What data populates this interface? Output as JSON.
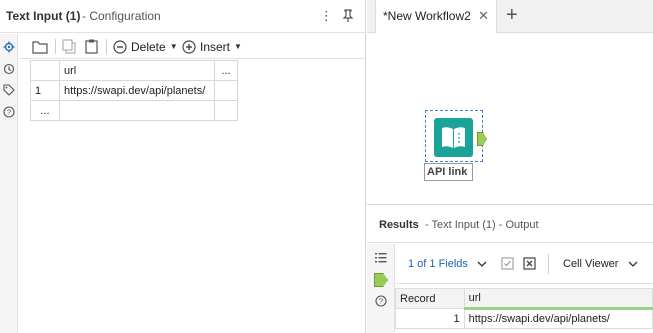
{
  "config": {
    "title": "Text Input (1)",
    "subtitle": "- Configuration"
  },
  "toolbar": {
    "delete_label": "Delete",
    "insert_label": "Insert"
  },
  "input_grid": {
    "header_cell": "url",
    "header_more": "...",
    "rows": [
      {
        "num": "1",
        "value": "https://swapi.dev/api/planets/"
      }
    ],
    "new_row_marker": "..."
  },
  "workflow": {
    "tab_label": "*New Workflow2",
    "tool_label": "API link",
    "tool_icon": "book-icon",
    "accent": "#1aa398",
    "anchor_color": "#9bcb57"
  },
  "results": {
    "title": "Results",
    "subtitle": "- Text Input (1) - Output",
    "fields_label": "1 of 1 Fields",
    "cell_viewer_label": "Cell Viewer",
    "columns": [
      "Record",
      "url"
    ],
    "rows": [
      {
        "record": "1",
        "url": "https://swapi.dev/api/planets/"
      }
    ]
  }
}
